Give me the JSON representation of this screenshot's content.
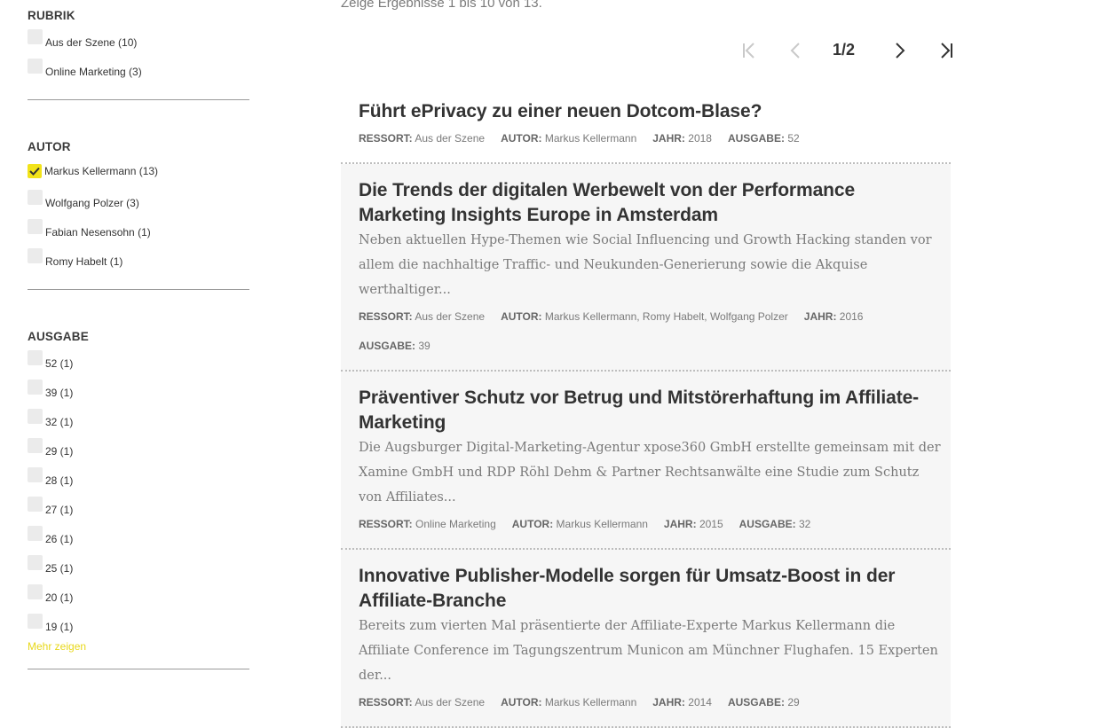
{
  "sidebar": {
    "rubrik": {
      "title": "RUBRIK",
      "items": [
        {
          "label": "Aus der Szene (10)",
          "checked": false
        },
        {
          "label": "Online Marketing (3)",
          "checked": false
        }
      ]
    },
    "autor": {
      "title": "AUTOR",
      "items": [
        {
          "label": "Markus Kellermann (13)",
          "checked": true
        },
        {
          "label": "Wolfgang Polzer (3)",
          "checked": false
        },
        {
          "label": "Fabian Nesensohn (1)",
          "checked": false
        },
        {
          "label": "Romy Habelt (1)",
          "checked": false
        }
      ]
    },
    "ausgabe": {
      "title": "AUSGABE",
      "items": [
        {
          "label": "52 (1)"
        },
        {
          "label": "39 (1)"
        },
        {
          "label": "32 (1)"
        },
        {
          "label": "29 (1)"
        },
        {
          "label": "28 (1)"
        },
        {
          "label": "27 (1)"
        },
        {
          "label": "26 (1)"
        },
        {
          "label": "25 (1)"
        },
        {
          "label": "20 (1)"
        },
        {
          "label": "19 (1)"
        }
      ],
      "more_label": "Mehr zeigen"
    }
  },
  "main": {
    "result_info": "Zeige Ergebnisse 1 bis 10 von 13.",
    "pagination": {
      "current": "1/2"
    },
    "meta_labels": {
      "ressort": "RESSORT:",
      "autor": "AUTOR:",
      "jahr": "JAHR:",
      "ausgabe": "AUSGABE:"
    },
    "results": [
      {
        "title": "Führt ePrivacy zu einer neuen Dotcom-Blase?",
        "teaser": "",
        "ressort": "Aus der Szene",
        "autor": "Markus Kellermann",
        "jahr": "2018",
        "ausgabe": "52"
      },
      {
        "title": "Die Trends der digitalen Werbewelt von der Performance Marketing Insights Europe in Amsterdam",
        "teaser": "Neben aktuellen Hype-Themen wie Social Influencing und Growth Hacking standen vor allem die nachhaltige Traffic- und Neukunden-Generierung sowie die Akquise werthaltiger...",
        "ressort": "Aus der Szene",
        "autor": "Markus Kellermann, Romy Habelt, Wolfgang Polzer",
        "jahr": "2016",
        "ausgabe": "39"
      },
      {
        "title": "Präventiver Schutz vor Betrug und Mitstörerhaftung im Affiliate-Marketing",
        "teaser": "Die Augsburger Digital-Marketing-Agentur xpose360 GmbH erstellte gemeinsam mit der Xamine GmbH und RDP Röhl Dehm & Partner Rechtsanwälte eine Studie zum Schutz von Affiliates...",
        "ressort": "Online Marketing",
        "autor": "Markus Kellermann",
        "jahr": "2015",
        "ausgabe": "32"
      },
      {
        "title": "Innovative Publisher-Modelle sorgen für Umsatz-Boost in der Affiliate-Branche",
        "teaser": "Bereits zum vierten Mal präsentierte der Affiliate-Experte Markus Kellermann die Affiliate Conference im Tagungszentrum Municon am Münchner Flughafen. 15 Experten der...",
        "ressort": "Aus der Szene",
        "autor": "Markus Kellermann",
        "jahr": "2014",
        "ausgabe": "29"
      }
    ]
  },
  "colors": {
    "accent": "#f2e31a",
    "link": "#e8d81a",
    "text": "#333333",
    "muted": "#7a7a7a"
  },
  "icons": [
    "first-page-icon",
    "prev-page-icon",
    "next-page-icon",
    "last-page-icon",
    "checkmark-icon"
  ]
}
